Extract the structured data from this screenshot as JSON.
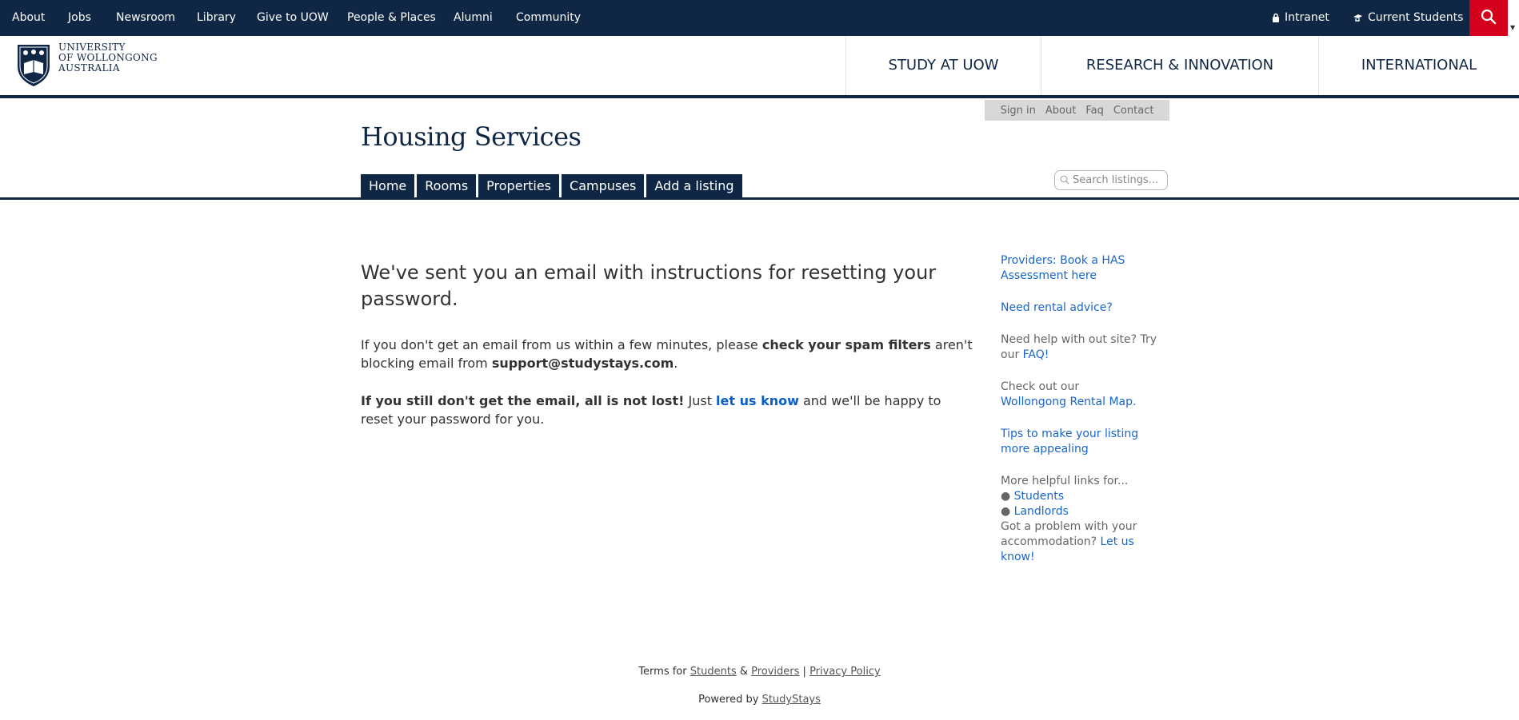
{
  "topbar": {
    "links": [
      "About",
      "Jobs",
      "Newsroom",
      "Library",
      "Give to UOW",
      "People & Places",
      "Alumni",
      "Community"
    ],
    "intranet": "Intranet",
    "current_students": "Current Students",
    "search_icon": "search-icon",
    "colors": {
      "navy": "#0f2745",
      "red": "#d5001c"
    }
  },
  "logo": {
    "lines": [
      "UNIVERSITY",
      "OF WOLLONGONG",
      "AUSTRALIA"
    ]
  },
  "mainnav": [
    "STUDY AT UOW",
    "RESEARCH & INNOVATION",
    "INTERNATIONAL"
  ],
  "housing": {
    "util_links": [
      "Sign in",
      "About",
      "Faq",
      "Contact"
    ],
    "title": "Housing Services",
    "tabs": [
      "Home",
      "Rooms",
      "Properties",
      "Campuses",
      "Add a listing"
    ],
    "search_placeholder": "Search listings..."
  },
  "content": {
    "heading": "We've sent you an email with instructions for resetting your password.",
    "p1_a": "If you don't get an email from us within a few minutes, please ",
    "p1_b": "check your spam filters",
    "p1_c": " aren't blocking email from ",
    "p1_d": "support@studystays.com",
    "p1_e": ".",
    "p2_a": "If you still don't get the email, all is not lost!",
    "p2_b": " Just ",
    "p2_link": "let us know",
    "p2_c": " and we'll be happy to reset your password for you."
  },
  "sidebar": {
    "book_has": "Providers: Book a HAS Assessment here",
    "rental_advice": "Need rental advice?",
    "help_text": "Need help with out site? Try our ",
    "faq": "FAQ!",
    "checkout_text": "Check out our ",
    "rental_map": "Wollongong Rental Map.",
    "tips": "Tips to make your listing more appealing",
    "more_links": "More helpful links for...",
    "students": "Students",
    "landlords": "Landlords",
    "problem_text": "Got a problem with your accommodation? ",
    "let_us_know": "Let us know!"
  },
  "footer": {
    "terms_for": "Terms for ",
    "students": "Students",
    "amp": " & ",
    "providers": "Providers",
    "pipe": " | ",
    "privacy": "Privacy Policy",
    "powered_by": "Powered by ",
    "studystays": "StudyStays"
  }
}
